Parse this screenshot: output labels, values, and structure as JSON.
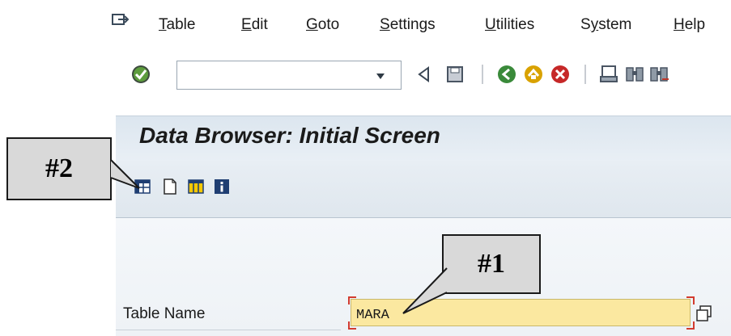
{
  "menu": [
    {
      "label": "Table",
      "accel": "T",
      "rest": "able"
    },
    {
      "label": "Edit",
      "accel": "E",
      "rest": "dit"
    },
    {
      "label": "Goto",
      "accel": "G",
      "rest": "oto"
    },
    {
      "label": "Settings",
      "accel": "S",
      "rest": "ettings"
    },
    {
      "label": "Utilities",
      "accel": "U",
      "rest": "tilities"
    },
    {
      "label": "System",
      "accel": "y",
      "pre": "S",
      "rest": "stem"
    },
    {
      "label": "Help",
      "accel": "H",
      "rest": "elp"
    }
  ],
  "title": "Data Browser: Initial Screen",
  "table_field": {
    "label": "Table Name",
    "value": "MARA"
  },
  "callouts": {
    "one": "#1",
    "two": "#2"
  },
  "icons": {
    "menu": "menu-icon",
    "enter": "green-check-icon",
    "back": "back-icon",
    "exit": "exit-icon",
    "cancel": "cancel-icon",
    "save": "save-icon",
    "print": "print-icon",
    "find": "find-icon",
    "find_next": "find-next-icon",
    "table_contents": "table-contents-icon",
    "new_entries": "new-entries-icon",
    "list": "list-icon",
    "info": "info-icon"
  },
  "colors": {
    "input_bg": "#fbe8a0",
    "title_bar": "#dce6ef",
    "callout_bg": "#d9d9d9"
  }
}
